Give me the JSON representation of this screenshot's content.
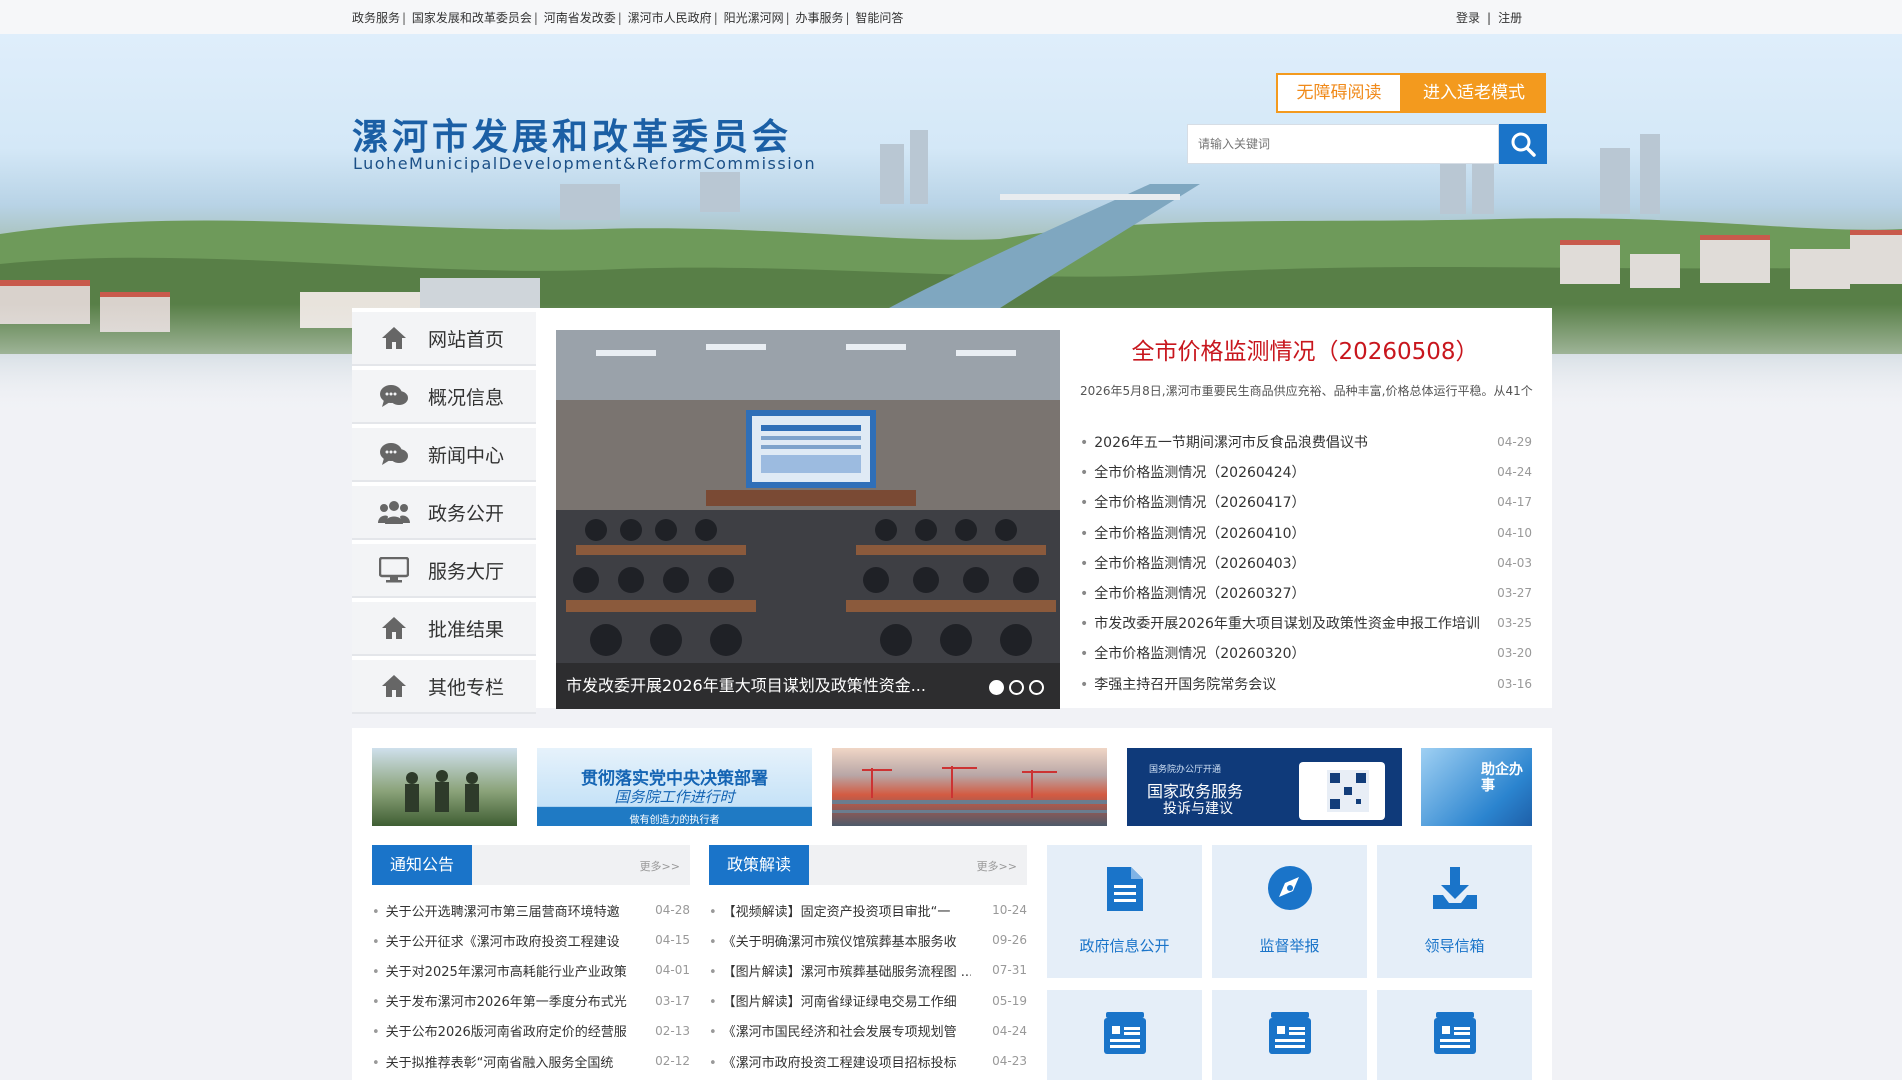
{
  "topbar": {
    "links": [
      "政务服务",
      "国家发展和改革委员会",
      "河南省发改委",
      "漯河市人民政府",
      "阳光漯河网",
      "办事服务",
      "智能问答"
    ],
    "login": "登录",
    "register": "注册"
  },
  "header": {
    "title": "漯河市发展和改革委员会",
    "subtitle": "LuoheMunicipalDevelopment&ReformCommission",
    "accessible_button": "无障碍阅读",
    "elder_button": "进入适老模式",
    "search_placeholder": "请输入关键词",
    "colors": {
      "brand_blue": "#1b5fa5",
      "accent_orange": "#f39a1e",
      "search_blue": "#1a74c9"
    }
  },
  "sidebar": {
    "items": [
      {
        "label": "网站首页",
        "icon": "home-icon"
      },
      {
        "label": "概况信息",
        "icon": "chat-icon"
      },
      {
        "label": "新闻中心",
        "icon": "chat-icon"
      },
      {
        "label": "政务公开",
        "icon": "users-icon"
      },
      {
        "label": "服务大厅",
        "icon": "monitor-icon"
      },
      {
        "label": "批准结果",
        "icon": "home-icon"
      },
      {
        "label": "其他专栏",
        "icon": "home-icon"
      }
    ]
  },
  "slideshow": {
    "caption": "市发改委开展2026年重大项目谋划及政策性资金...",
    "active_index": 0,
    "count": 3
  },
  "news": {
    "headline": "全市价格监测情况（20260508）",
    "summary": "2026年5月8日,漯河市重要民生商品供应充裕、品种丰富,价格总体运行平稳。从41个",
    "items": [
      {
        "title": "2026年五一节期间漯河市反食品浪费倡议书",
        "date": "04-29"
      },
      {
        "title": "全市价格监测情况（20260424）",
        "date": "04-24"
      },
      {
        "title": "全市价格监测情况（20260417）",
        "date": "04-17"
      },
      {
        "title": "全市价格监测情况（20260410）",
        "date": "04-10"
      },
      {
        "title": "全市价格监测情况（20260403）",
        "date": "04-03"
      },
      {
        "title": "全市价格监测情况（20260327）",
        "date": "03-27"
      },
      {
        "title": "市发改委开展2026年重大项目谋划及政策性资金申报工作培训",
        "date": "03-25"
      },
      {
        "title": "全市价格监测情况（20260320）",
        "date": "03-20"
      },
      {
        "title": "李强主持召开国务院常务会议",
        "date": "03-16"
      }
    ]
  },
  "banners": {
    "b2_line1": "贯彻落实党中央决策部署",
    "b2_line2": "国务院工作进行时",
    "b2_line3": "做有创造力的执行者",
    "b4_line1": "国务院办公厅开通",
    "b4_line2": "国家政务服务",
    "b4_line3": "投诉与建议",
    "b5_text": "助企办事"
  },
  "notices": {
    "tab": "通知公告",
    "more": "更多>>",
    "items": [
      {
        "title": "关于公开选聘漯河市第三届营商环境特邀",
        "date": "04-28"
      },
      {
        "title": "关于公开征求《漯河市政府投资工程建设",
        "date": "04-15"
      },
      {
        "title": "关于对2025年漯河市高耗能行业产业政策",
        "date": "04-01"
      },
      {
        "title": "关于发布漯河市2026年第一季度分布式光",
        "date": "03-17"
      },
      {
        "title": "关于公布2026版河南省政府定价的经营服",
        "date": "02-13"
      },
      {
        "title": "关于拟推荐表彰“河南省融入服务全国统",
        "date": "02-12"
      }
    ]
  },
  "policy": {
    "tab": "政策解读",
    "more": "更多>>",
    "items": [
      {
        "title": "【视频解读】固定资产投资项目审批“一",
        "date": "10-24"
      },
      {
        "title": "《关于明确漯河市殡仪馆殡葬基本服务收",
        "date": "09-26"
      },
      {
        "title": "【图片解读】漯河市殡葬基础服务流程图 ...",
        "date": "07-31"
      },
      {
        "title": "【图片解读】河南省绿证绿电交易工作细",
        "date": "05-19"
      },
      {
        "title": "《漯河市国民经济和社会发展专项规划管",
        "date": "04-24"
      },
      {
        "title": "《漯河市政府投资工程建设项目招标投标",
        "date": "04-23"
      }
    ]
  },
  "services": [
    {
      "label": "政府信息公开",
      "icon": "document-icon"
    },
    {
      "label": "监督举报",
      "icon": "compass-icon"
    },
    {
      "label": "领导信箱",
      "icon": "download-icon"
    },
    {
      "label": "",
      "icon": "article-icon"
    },
    {
      "label": "",
      "icon": "article-icon"
    },
    {
      "label": "",
      "icon": "article-icon"
    }
  ]
}
